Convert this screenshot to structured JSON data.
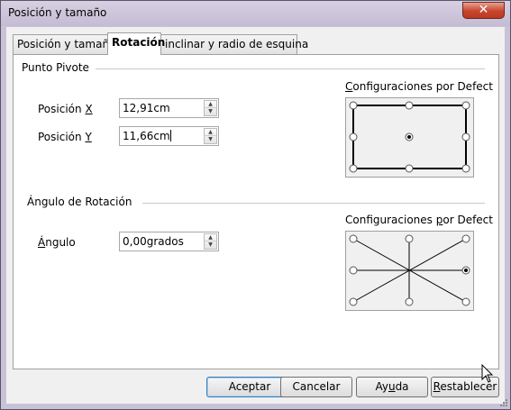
{
  "window": {
    "title": "Posición y tamaño",
    "close_symbol": "✕"
  },
  "tabs": [
    {
      "label": "Posición y tamaño",
      "active": false
    },
    {
      "label": "Rotación",
      "active": true
    },
    {
      "label": "inclinar y radio de esquina",
      "active": false
    }
  ],
  "pivot": {
    "section_title": "Punto Pivote",
    "pos_x_label": "Posición ",
    "pos_x_key": "X",
    "pos_x_value": "12,91cm",
    "pos_y_label": "Posición ",
    "pos_y_key": "Y",
    "pos_y_value": "11,66cm",
    "config_pre": "",
    "config_key": "C",
    "config_post": "onfiguraciones por Defect"
  },
  "rotation": {
    "section_title": "Ángulo de Rotación",
    "angle_key": "Á",
    "angle_label": "ngulo",
    "angle_value": "0,00grados",
    "config_pre": "Configuraciones ",
    "config_key": "p",
    "config_post": "or Defect"
  },
  "buttons": {
    "ok": "Aceptar",
    "cancel": "Cancelar",
    "help_pre": "Ay",
    "help_key": "u",
    "help_post": "da",
    "reset_key": "R",
    "reset_post": "establecer"
  },
  "colors": {
    "accent": "#3c7fb1",
    "title_bar": "#c9c2d6",
    "close": "#c8452d"
  }
}
